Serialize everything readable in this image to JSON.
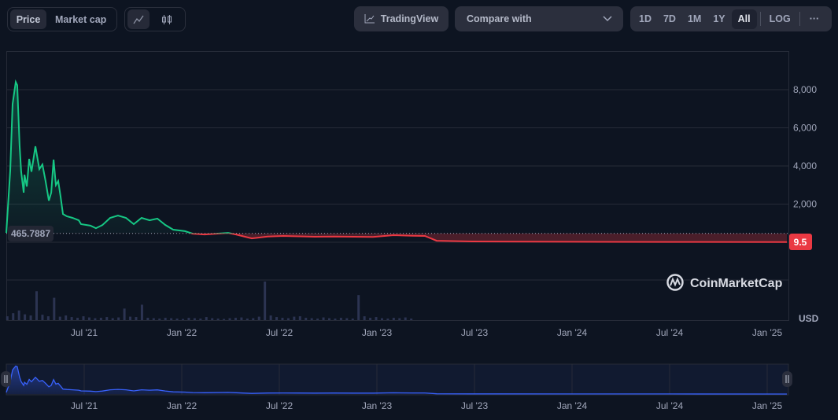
{
  "toolbar": {
    "metric_tabs": [
      {
        "label": "Price",
        "active": true
      },
      {
        "label": "Market cap",
        "active": false
      }
    ],
    "chart_types": [
      {
        "icon": "line-chart-icon",
        "active": true
      },
      {
        "icon": "candlestick-icon",
        "active": false
      }
    ],
    "tradingview_label": "TradingView",
    "compare_placeholder": "Compare with",
    "ranges": [
      {
        "label": "1D"
      },
      {
        "label": "7D"
      },
      {
        "label": "1M"
      },
      {
        "label": "1Y"
      },
      {
        "label": "All",
        "active": true
      }
    ],
    "log_label": "LOG",
    "more_label": "···"
  },
  "brand": {
    "watermark": "CoinMarketCap"
  },
  "colors": {
    "up": "#16c784",
    "down": "#ea3943",
    "nav": "#3861fb",
    "bg": "#0d1421",
    "grid": "#262b38"
  },
  "chart_data": {
    "type": "line",
    "currency_label": "USD",
    "baseline_value": 465.7887,
    "baseline_label": "465.7887",
    "current_value": 9.5,
    "current_label": "9.5",
    "y_ticks": [
      {
        "v": 2000,
        "label": "2,000"
      },
      {
        "v": 4000,
        "label": "4,000"
      },
      {
        "v": 6000,
        "label": "6,000"
      },
      {
        "v": 8000,
        "label": "8,000"
      }
    ],
    "ylim": [
      0,
      9500
    ],
    "x_ticks": [
      {
        "t": 2021.5,
        "label": "Jul '21"
      },
      {
        "t": 2022.0,
        "label": "Jan '22"
      },
      {
        "t": 2022.5,
        "label": "Jul '22"
      },
      {
        "t": 2023.0,
        "label": "Jan '23"
      },
      {
        "t": 2023.5,
        "label": "Jul '23"
      },
      {
        "t": 2024.0,
        "label": "Jan '24"
      },
      {
        "t": 2024.5,
        "label": "Jul '24"
      },
      {
        "t": 2025.0,
        "label": "Jan '25"
      }
    ],
    "x_unit": "decimal year",
    "price": [
      [
        2021.101,
        490
      ],
      [
        2021.121,
        3750
      ],
      [
        2021.133,
        7250
      ],
      [
        2021.149,
        8400
      ],
      [
        2021.157,
        8240
      ],
      [
        2021.169,
        5070
      ],
      [
        2021.177,
        3700
      ],
      [
        2021.19,
        2600
      ],
      [
        2021.194,
        3540
      ],
      [
        2021.206,
        2920
      ],
      [
        2021.218,
        4370
      ],
      [
        2021.23,
        3700
      ],
      [
        2021.25,
        5030
      ],
      [
        2021.27,
        3830
      ],
      [
        2021.286,
        4080
      ],
      [
        2021.302,
        3210
      ],
      [
        2021.319,
        2180
      ],
      [
        2021.331,
        2600
      ],
      [
        2021.343,
        4330
      ],
      [
        2021.355,
        3000
      ],
      [
        2021.367,
        3210
      ],
      [
        2021.379,
        2390
      ],
      [
        2021.391,
        1480
      ],
      [
        2021.411,
        1360
      ],
      [
        2021.44,
        1280
      ],
      [
        2021.472,
        1150
      ],
      [
        2021.484,
        950
      ],
      [
        2021.532,
        870
      ],
      [
        2021.56,
        740
      ],
      [
        2021.593,
        900
      ],
      [
        2021.633,
        1280
      ],
      [
        2021.673,
        1400
      ],
      [
        2021.714,
        1280
      ],
      [
        2021.754,
        950
      ],
      [
        2021.794,
        1280
      ],
      [
        2021.835,
        1150
      ],
      [
        2021.875,
        1240
      ],
      [
        2021.915,
        910
      ],
      [
        2021.956,
        660
      ],
      [
        2022.016,
        580
      ],
      [
        2022.056,
        450
      ],
      [
        2022.117,
        410
      ],
      [
        2022.238,
        490
      ],
      [
        2022.278,
        410
      ],
      [
        2022.359,
        200
      ],
      [
        2022.44,
        300
      ],
      [
        2022.52,
        330
      ],
      [
        2022.6,
        310
      ],
      [
        2022.681,
        290
      ],
      [
        2022.78,
        300
      ],
      [
        2022.883,
        290
      ],
      [
        2022.98,
        280
      ],
      [
        2023.085,
        370
      ],
      [
        2023.18,
        340
      ],
      [
        2023.246,
        330
      ],
      [
        2023.306,
        80
      ],
      [
        2023.488,
        40
      ],
      [
        2024.0,
        25
      ],
      [
        2024.5,
        18
      ],
      [
        2025.101,
        9.5
      ]
    ],
    "volume": {
      "start": 2021.1,
      "interval_years": 0.03,
      "max": 100,
      "values": [
        10,
        18,
        25,
        15,
        12,
        75,
        14,
        10,
        58,
        9,
        12,
        8,
        6,
        10,
        7,
        5,
        6,
        8,
        5,
        7,
        30,
        9,
        8,
        40,
        6,
        5,
        4,
        6,
        5,
        4,
        3,
        6,
        5,
        4,
        8,
        5,
        4,
        3,
        5,
        6,
        7,
        4,
        5,
        9,
        100,
        12,
        8,
        6,
        5,
        9,
        10,
        6,
        5,
        4,
        7,
        5,
        4,
        6,
        5,
        4,
        65,
        10,
        6,
        8,
        5,
        4,
        6,
        5,
        7,
        4
      ]
    }
  }
}
